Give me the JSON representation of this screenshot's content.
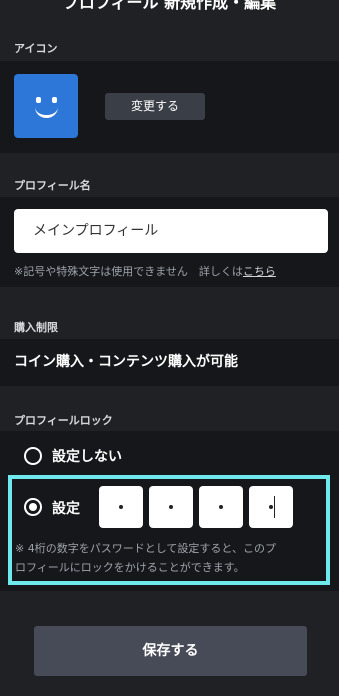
{
  "header": {
    "title": "プロフィール 新規作成・編集"
  },
  "icon_section": {
    "label": "アイコン",
    "change_button": "変更する",
    "avatar_icon": "smiley-face-icon"
  },
  "name_section": {
    "label": "プロフィール名",
    "value": "メインプロフィール",
    "note_prefix": "※記号や特殊文字は使用できません　詳しくは",
    "note_link": "こちら"
  },
  "purchase_section": {
    "label": "購入制限",
    "value": "コイン購入・コンテンツ購入が可能"
  },
  "lock_section": {
    "label": "プロフィールロック",
    "option_off": "設定しない",
    "option_on": "設定",
    "selected": "設定",
    "pin_digits": 4,
    "note_line1": "※ 4桁の数字をパスワードとして設定すると、このプ",
    "note_line2": "ロフィールにロックをかけることができます。",
    "highlight_color": "#6fe8ee"
  },
  "footer": {
    "save_button": "保存する"
  }
}
